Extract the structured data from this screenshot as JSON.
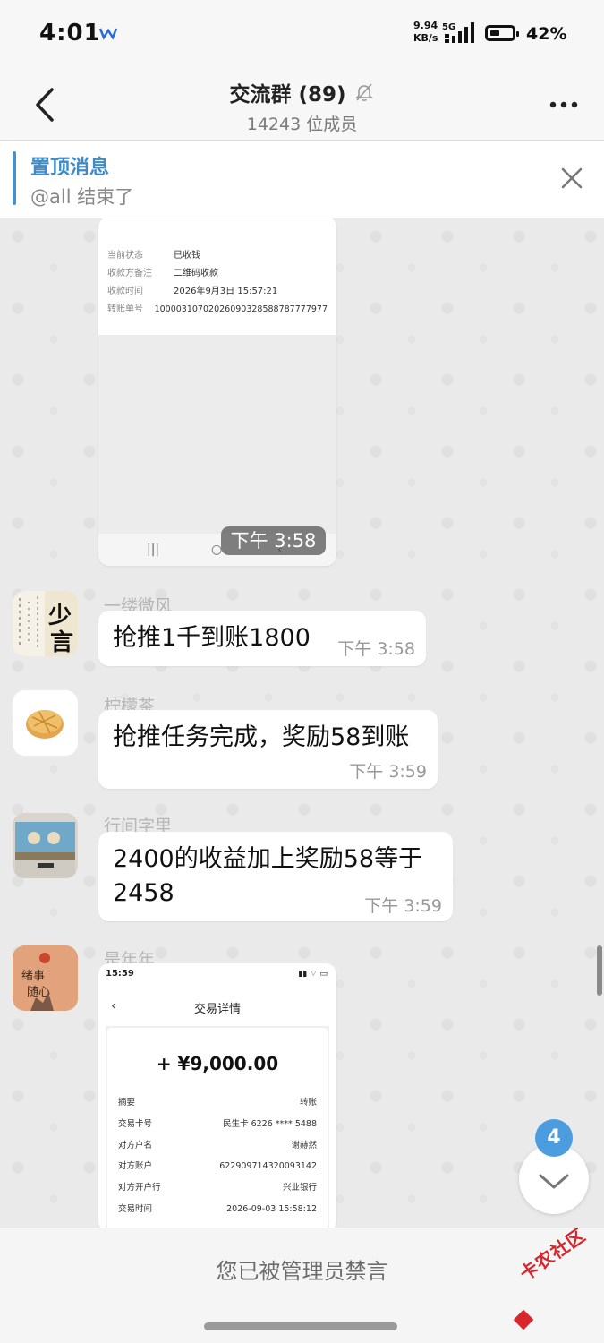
{
  "status_bar": {
    "time": "4:01",
    "speed_value": "9.94",
    "speed_unit": "KB/s",
    "network": "5G",
    "battery": "42%"
  },
  "header": {
    "title": "交流群 (89)",
    "subtitle": "14243 位成员"
  },
  "pinned": {
    "label": "置顶消息",
    "text": "@all 结束了"
  },
  "messages": [
    {
      "type": "image",
      "receipt": [
        {
          "label": "当前状态",
          "value": "已收钱"
        },
        {
          "label": "收款方备注",
          "value": "二维码收款"
        },
        {
          "label": "收款时间",
          "value": "2026年9月3日 15:57:21"
        },
        {
          "label": "转账单号",
          "value": "10000310702026090328588787777977"
        }
      ],
      "time": "下午 3:58"
    },
    {
      "sender": "一缕微风",
      "text": "抢推1千到账1800",
      "time": "下午 3:58"
    },
    {
      "sender": "柠檬茶",
      "text": "抢推任务完成，奖励58到账",
      "time": "下午 3:59"
    },
    {
      "sender": "行间字里",
      "text_line1": "2400的收益加上奖励58等于",
      "text_line2": "2458",
      "time": "下午 3:59"
    },
    {
      "sender": "是年年",
      "type": "image",
      "screenshot": {
        "status_time": "15:59",
        "title": "交易详情",
        "amount": "+ ¥9,000.00",
        "rows": [
          {
            "label": "摘要",
            "value": "转账"
          },
          {
            "label": "交易卡号",
            "value": "民生卡 6226 **** 5488"
          },
          {
            "label": "对方户名",
            "value": "谢赫然"
          },
          {
            "label": "对方账户",
            "value": "622909714320093142"
          },
          {
            "label": "对方开户行",
            "value": "兴业银行"
          },
          {
            "label": "交易时间",
            "value": "2026-09-03 15:58:12"
          }
        ]
      }
    }
  ],
  "avatar_text": {
    "calligraphy": "少言",
    "painting": "绪事随心"
  },
  "unread_count": "4",
  "footer": {
    "muted_notice": "您已被管理员禁言"
  },
  "watermark": "卡农社区",
  "colors": {
    "accent": "#3f8bc6",
    "badge": "#4c9de0",
    "watermark": "#d8262c"
  }
}
